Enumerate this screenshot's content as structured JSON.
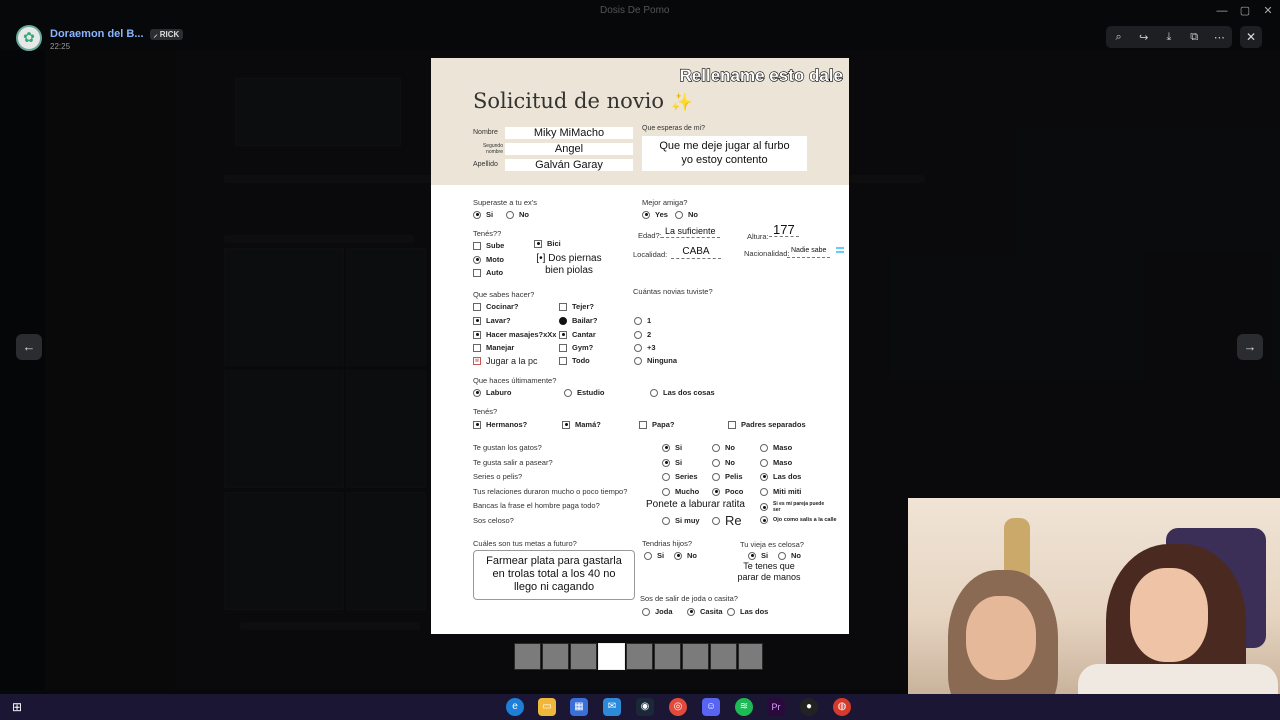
{
  "window": {
    "title": "Doraemon del B...",
    "app_title": "Dosis De Pomo",
    "controls": [
      "—",
      "▢",
      "✕"
    ]
  },
  "viewer": {
    "username": "Doraemon del B...",
    "role_badge": "RICK",
    "time": "22:25",
    "tool_icons": [
      "zoom-icon",
      "share-icon",
      "download-icon",
      "open-external-icon",
      "more-icon"
    ],
    "close": "✕",
    "prev": "←",
    "next": "→"
  },
  "form": {
    "caption": "Rellename esto dale",
    "title": "Solicitud de novio",
    "sparkle": "✨",
    "labels": {
      "nombre": "Nombre",
      "segundo": "Segundo nombre",
      "apellido": "Apellido",
      "esperas": "Que esperas de mi?"
    },
    "values": {
      "nombre": "Miky MiMacho",
      "segundo": "Angel",
      "apellido": "Galván Garay",
      "esperas_1": "Que me deje jugar al furbo",
      "esperas_2": "yo estoy contento"
    },
    "superaste": {
      "q": "Superaste a tu ex's",
      "si": "Si",
      "no": "No"
    },
    "mejor_amiga": {
      "q": "Mejor amiga?",
      "yes": "Yes",
      "no": "No"
    },
    "tenes": {
      "q": "Tenés??",
      "sube": "Sube",
      "moto": "Moto",
      "auto": "Auto",
      "bici": "Bici",
      "piernas_1": "[•] Dos piernas",
      "piernas_2": "bien piolas"
    },
    "edad": {
      "label": "Edad?:",
      "value": "La suficiente"
    },
    "altura": {
      "label": "Altura:",
      "value": "177"
    },
    "localidad": {
      "label": "Localidad:",
      "value": "CABA"
    },
    "nacionalidad": {
      "label": "Nacionalidad:",
      "value": "Nadie sabe"
    },
    "sabes": {
      "q": "Que sabes hacer?",
      "cocinar": "Cocinar?",
      "lavar": "Lavar?",
      "masajes": "Hacer masajes?xXx",
      "manejar": "Manejar",
      "jugar": "Jugar a la pc",
      "tejer": "Tejer?",
      "bailar": "Bailar?",
      "cantar": "Cantar",
      "gym": "Gym?",
      "todo": "Todo"
    },
    "novias": {
      "q": "Cuántas novias tuviste?",
      "o1": "1",
      "o2": "2",
      "o3": "+3",
      "o4": "Ninguna"
    },
    "ultimamente": {
      "q": "Que haces últimamente?",
      "laburo": "Laburo",
      "estudio": "Estudio",
      "ambas": "Las dos cosas"
    },
    "tenes2": {
      "q": "Tenés?",
      "hermanos": "Hermanos?",
      "mama": "Mamá?",
      "papa": "Papa?",
      "padres": "Padres separados"
    },
    "gatos": {
      "q": "Te gustan los gatos?",
      "a": "Si",
      "b": "No",
      "c": "Maso"
    },
    "pasear": {
      "q": "Te gusta salir a pasear?",
      "a": "Si",
      "b": "No",
      "c": "Maso"
    },
    "series": {
      "q": "Series o pelis?",
      "a": "Series",
      "b": "Pelis",
      "c": "Las dos"
    },
    "relaciones": {
      "q": "Tus relaciones duraron mucho o poco tiempo?",
      "a": "Mucho",
      "b": "Poco",
      "c": "Miti miti"
    },
    "bancas": {
      "q": "Bancas la frase el hombre paga todo?",
      "hand": "Ponete a laburar ratita",
      "opt": "Si es mi pareja puede ser"
    },
    "celoso": {
      "q": "Sos celoso?",
      "a": "Si muy",
      "hand": "Re",
      "c": "Ojo como salis a la calle"
    },
    "metas": {
      "q": "Cuáles son tus metas a futuro?",
      "l1": "Farmear plata para gastarla",
      "l2": "en trolas total a los 40 no",
      "l3": "llego ni cagando"
    },
    "hijos": {
      "q": "Tendrias hijos?",
      "si": "Si",
      "no": "No"
    },
    "vieja": {
      "q": "Tu vieja es celosa?",
      "si": "Si",
      "no": "No",
      "h1": "Te tenes que",
      "h2": "parar de manos"
    },
    "joda": {
      "q": "Sos de salir de joda o casita?",
      "a": "Joda",
      "b": "Casita",
      "c": "Las dos"
    }
  },
  "thumbnails": {
    "count": 9,
    "active_index": 3
  },
  "taskbar_icons": [
    "windows-icon",
    "edge-icon",
    "files-icon",
    "store-icon",
    "mail-icon",
    "steam-icon",
    "chrome-icon",
    "discord-icon",
    "spotify-icon",
    "premiere-icon",
    "obs-icon",
    "browser-icon"
  ]
}
